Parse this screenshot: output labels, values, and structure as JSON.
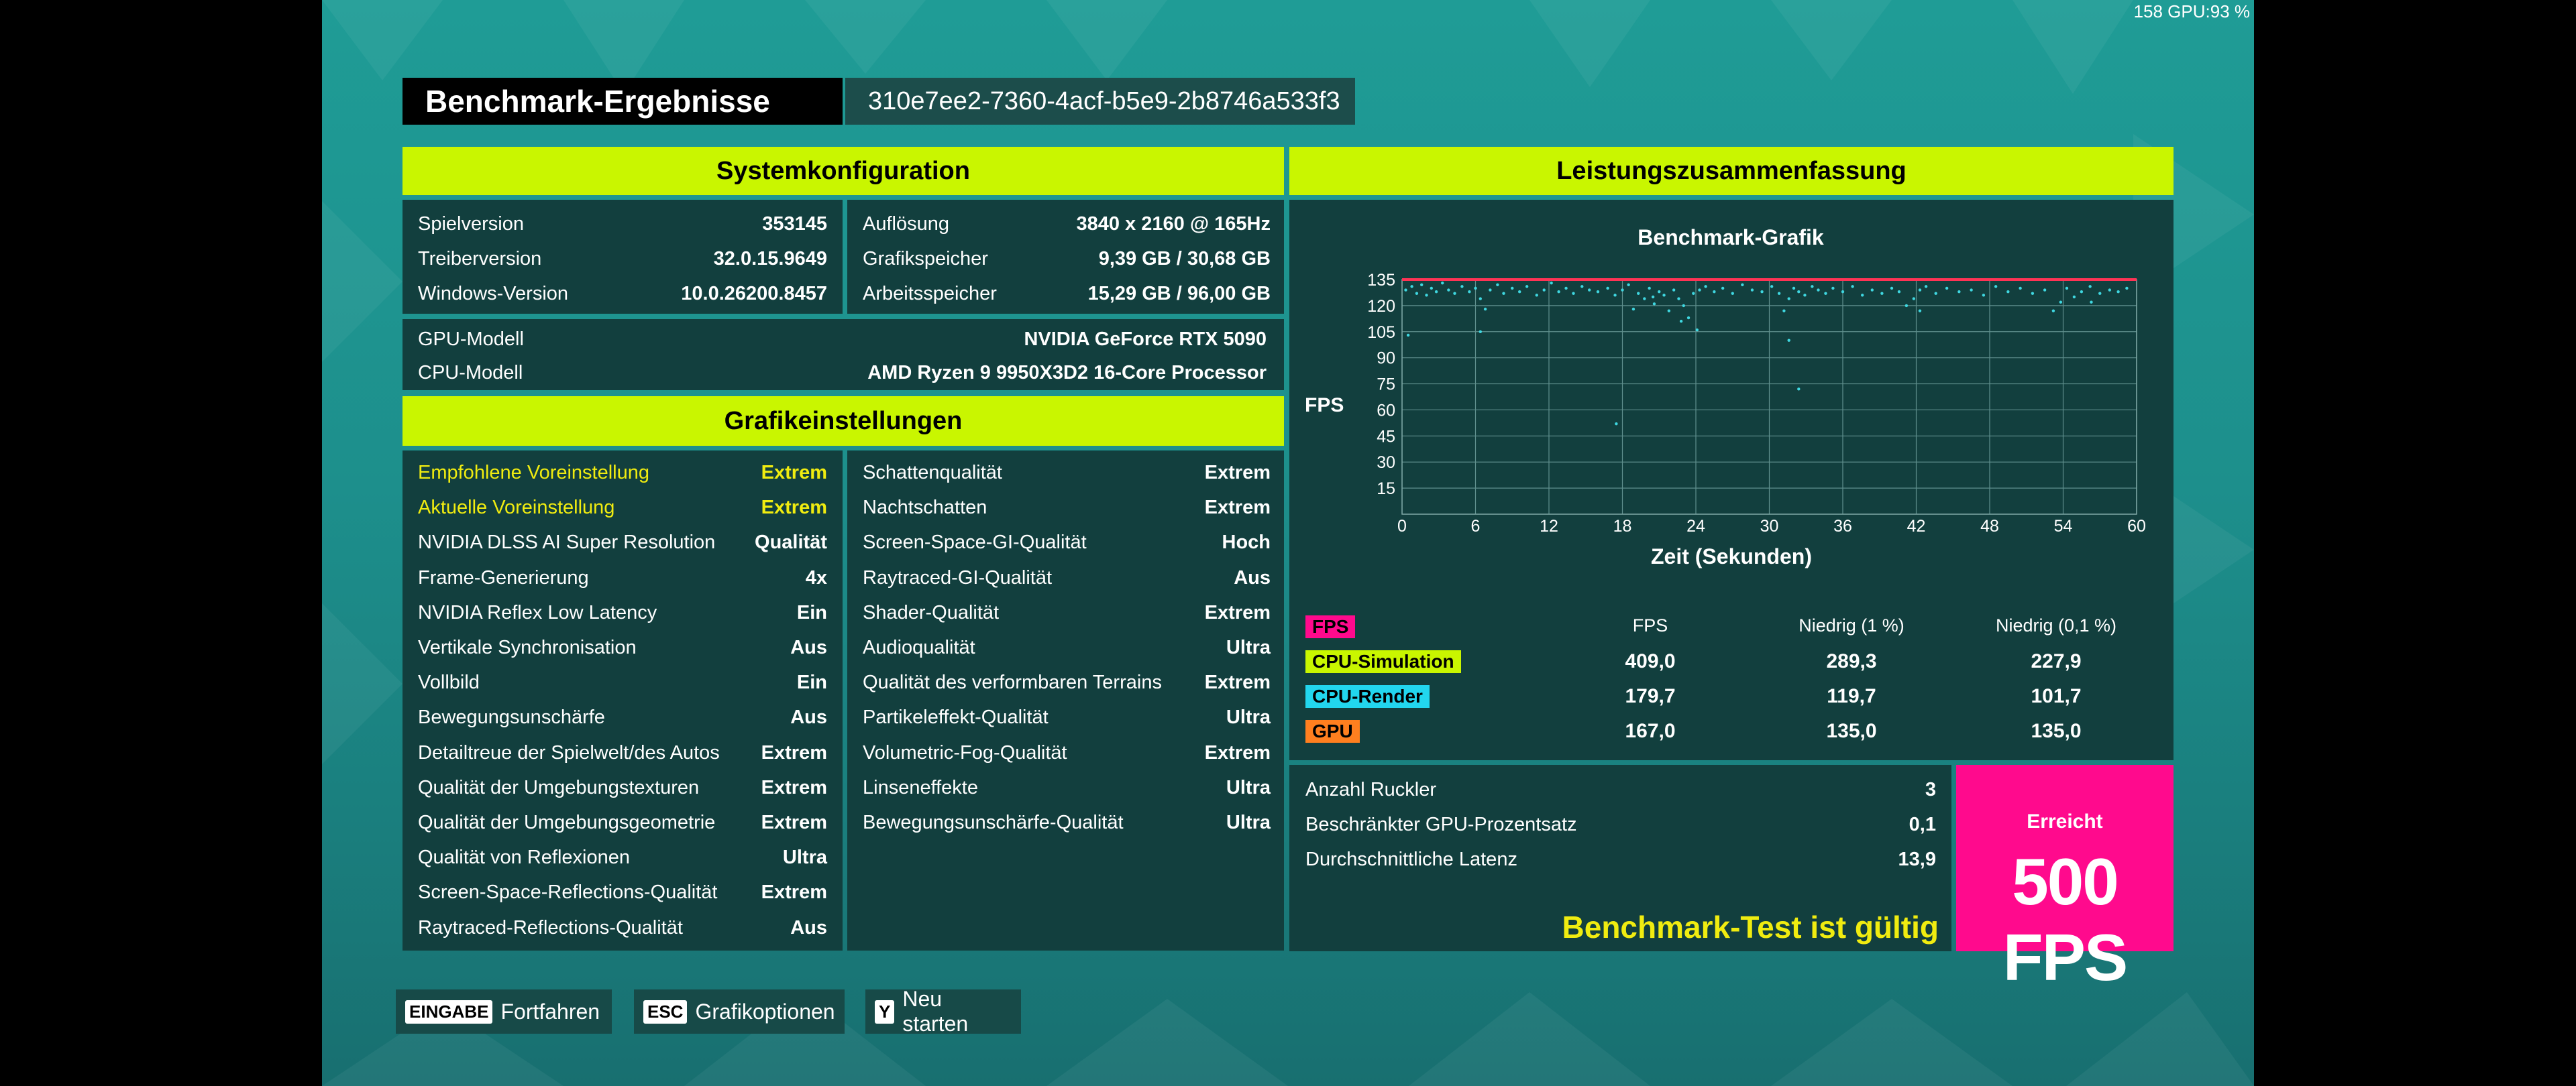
{
  "hud": "158 GPU:93 %",
  "header": {
    "title": "Benchmark-Ergebnisse",
    "run_id": "310e7ee2-7360-4acf-b5e9-2b8746a533f3"
  },
  "system": {
    "header": "Systemkonfiguration",
    "left": [
      {
        "label": "Spielversion",
        "value": "353145"
      },
      {
        "label": "Treiberversion",
        "value": "32.0.15.9649"
      },
      {
        "label": "Windows-Version",
        "value": "10.0.26200.8457"
      }
    ],
    "right": [
      {
        "label": "Auflösung",
        "value": "3840 x 2160 @ 165Hz"
      },
      {
        "label": "Grafikspeicher",
        "value": "9,39 GB / 30,68 GB"
      },
      {
        "label": "Arbeitsspeicher",
        "value": "15,29 GB / 96,00 GB"
      }
    ],
    "hw": [
      {
        "label": "GPU-Modell",
        "value": "NVIDIA GeForce RTX 5090"
      },
      {
        "label": "CPU-Modell",
        "value": "AMD Ryzen 9 9950X3D2 16-Core Processor"
      }
    ]
  },
  "graphics": {
    "header": "Grafikeinstellungen",
    "left": [
      {
        "label": "Empfohlene Voreinstellung",
        "value": "Extrem"
      },
      {
        "label": "Aktuelle Voreinstellung",
        "value": "Extrem"
      },
      {
        "label": "NVIDIA DLSS AI Super Resolution",
        "value": "Qualität"
      },
      {
        "label": "Frame-Generierung",
        "value": "4x"
      },
      {
        "label": "NVIDIA Reflex Low Latency",
        "value": "Ein"
      },
      {
        "label": "Vertikale Synchronisation",
        "value": "Aus"
      },
      {
        "label": "Vollbild",
        "value": "Ein"
      },
      {
        "label": "Bewegungsunschärfe",
        "value": "Aus"
      },
      {
        "label": "Detailtreue der Spielwelt/des Autos",
        "value": "Extrem"
      },
      {
        "label": "Qualität der Umgebungstexturen",
        "value": "Extrem"
      },
      {
        "label": "Qualität der Umgebungsgeometrie",
        "value": "Extrem"
      },
      {
        "label": "Qualität von Reflexionen",
        "value": "Ultra"
      },
      {
        "label": "Screen-Space-Reflections-Qualität",
        "value": "Extrem"
      },
      {
        "label": "Raytraced-Reflections-Qualität",
        "value": "Aus"
      }
    ],
    "right": [
      {
        "label": "Schattenqualität",
        "value": "Extrem"
      },
      {
        "label": "Nachtschatten",
        "value": "Extrem"
      },
      {
        "label": "Screen-Space-GI-Qualität",
        "value": "Hoch"
      },
      {
        "label": "Raytraced-GI-Qualität",
        "value": "Aus"
      },
      {
        "label": "Shader-Qualität",
        "value": "Extrem"
      },
      {
        "label": "Audioqualität",
        "value": "Ultra"
      },
      {
        "label": "Qualität des verformbaren Terrains",
        "value": "Extrem"
      },
      {
        "label": "Partikeleffekt-Qualität",
        "value": "Ultra"
      },
      {
        "label": "Volumetric-Fog-Qualität",
        "value": "Extrem"
      },
      {
        "label": "Linseneffekte",
        "value": "Ultra"
      },
      {
        "label": "Bewegungsunschärfe-Qualität",
        "value": "Ultra"
      }
    ]
  },
  "performance": {
    "header": "Leistungszusammenfassung",
    "table": {
      "columns": [
        "FPS",
        "Niedrig (1 %)",
        "Niedrig (0,1 %)"
      ],
      "rows": [
        {
          "name": "FPS",
          "color": "#ff0a8d",
          "values": [
            "",
            "",
            ""
          ]
        },
        {
          "name": "CPU-Simulation",
          "color": "#c9f600",
          "values": [
            "409,0",
            "289,3",
            "227,9"
          ]
        },
        {
          "name": "CPU-Render",
          "color": "#22d6ee",
          "values": [
            "179,7",
            "119,7",
            "101,7"
          ]
        },
        {
          "name": "GPU",
          "color": "#ff7f1f",
          "values": [
            "167,0",
            "135,0",
            "135,0"
          ]
        }
      ]
    },
    "stats": [
      {
        "label": "Anzahl Ruckler",
        "value": "3"
      },
      {
        "label": "Beschränkter GPU-Prozentsatz",
        "value": "0,1"
      },
      {
        "label": "Durchschnittliche Latenz",
        "value": "13,9"
      }
    ],
    "valid_text": "Benchmark-Test ist gültig",
    "achieved_label": "Erreicht",
    "achieved_value": "500 FPS"
  },
  "chart_data": {
    "type": "scatter",
    "title": "Benchmark-Grafik",
    "xlabel": "Zeit (Sekunden)",
    "ylabel": "FPS",
    "xlim": [
      0,
      60
    ],
    "ylim": [
      0,
      135
    ],
    "xticks": [
      0,
      6,
      12,
      18,
      24,
      30,
      36,
      42,
      48,
      54,
      60
    ],
    "yticks": [
      15,
      30,
      45,
      60,
      75,
      90,
      105,
      120,
      135
    ],
    "grid": true,
    "cap_line": {
      "value": 135,
      "color": "#ff3355"
    },
    "point_color": "#3fd7e0",
    "x": [
      0.3,
      0.8,
      1.2,
      1.6,
      2.0,
      2.4,
      2.8,
      3.3,
      3.8,
      4.3,
      4.9,
      5.5,
      6.0,
      6.4,
      6.8,
      7.2,
      7.8,
      8.3,
      9.0,
      9.6,
      10.2,
      11.0,
      11.6,
      12.2,
      12.8,
      13.4,
      14.0,
      14.7,
      15.3,
      16.0,
      16.8,
      17.4,
      18.0,
      18.5,
      18.9,
      19.3,
      19.8,
      20.2,
      20.6,
      21.0,
      21.4,
      21.8,
      22.2,
      22.6,
      23.0,
      23.4,
      23.8,
      24.3,
      24.8,
      25.5,
      26.2,
      27.0,
      27.8,
      28.6,
      29.4,
      30.2,
      30.8,
      31.2,
      31.6,
      32.0,
      32.4,
      32.9,
      33.5,
      34.0,
      34.6,
      35.2,
      36.0,
      36.8,
      37.6,
      38.4,
      39.2,
      40.0,
      40.6,
      41.2,
      41.8,
      42.3,
      42.8,
      43.6,
      44.5,
      45.5,
      46.5,
      47.5,
      48.5,
      49.5,
      50.5,
      51.5,
      52.5,
      53.2,
      53.8,
      54.3,
      54.9,
      55.5,
      56.2,
      57.0,
      57.8,
      58.5,
      59.2,
      6.4,
      22.8,
      24.1,
      31.6,
      32.4,
      17.5,
      20.5,
      0.5,
      42.3,
      56.3
    ],
    "y": [
      129,
      131,
      127,
      132,
      126,
      130,
      128,
      133,
      129,
      127,
      131,
      128,
      130,
      124,
      118,
      129,
      132,
      127,
      130,
      128,
      131,
      126,
      129,
      133,
      128,
      130,
      127,
      131,
      129,
      128,
      130,
      126,
      129,
      132,
      118,
      127,
      124,
      130,
      121,
      128,
      126,
      117,
      129,
      124,
      120,
      113,
      127,
      129,
      131,
      128,
      130,
      127,
      132,
      129,
      128,
      131,
      127,
      117,
      124,
      130,
      128,
      126,
      131,
      129,
      127,
      130,
      128,
      131,
      126,
      129,
      127,
      130,
      128,
      120,
      124,
      129,
      131,
      127,
      130,
      128,
      129,
      126,
      131,
      128,
      130,
      127,
      129,
      117,
      122,
      130,
      125,
      128,
      131,
      127,
      129,
      128,
      130,
      105,
      111,
      106,
      100,
      72,
      52,
      125,
      103,
      117,
      122,
      112
    ]
  },
  "footer": [
    {
      "key": "EINGABE",
      "label": "Fortfahren"
    },
    {
      "key": "ESC",
      "label": "Grafikoptionen"
    },
    {
      "key": "Y",
      "label": "Neu starten"
    }
  ]
}
